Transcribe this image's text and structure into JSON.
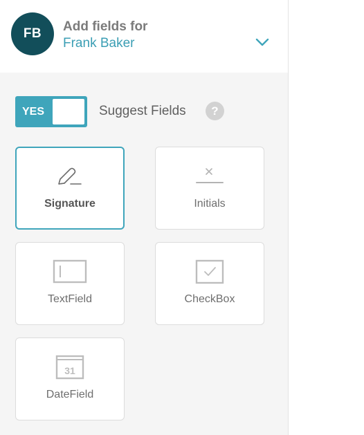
{
  "signer": {
    "initials": "FB",
    "header_label": "Add fields for",
    "name": "Frank Baker"
  },
  "suggest": {
    "toggle_label": "YES",
    "label": "Suggest Fields",
    "help": "?"
  },
  "fields": [
    {
      "label": "Signature",
      "icon": "signature-icon",
      "selected": true
    },
    {
      "label": "Initials",
      "icon": "initials-icon",
      "selected": false
    },
    {
      "label": "TextField",
      "icon": "text-field-icon",
      "selected": false
    },
    {
      "label": "CheckBox",
      "icon": "checkbox-icon",
      "selected": false
    },
    {
      "label": "DateField",
      "icon": "date-field-icon",
      "selected": false,
      "icon_text": "31"
    }
  ],
  "colors": {
    "accent": "#3fa5bb",
    "avatar": "#124e5a",
    "panel_bg": "#f5f5f5"
  }
}
